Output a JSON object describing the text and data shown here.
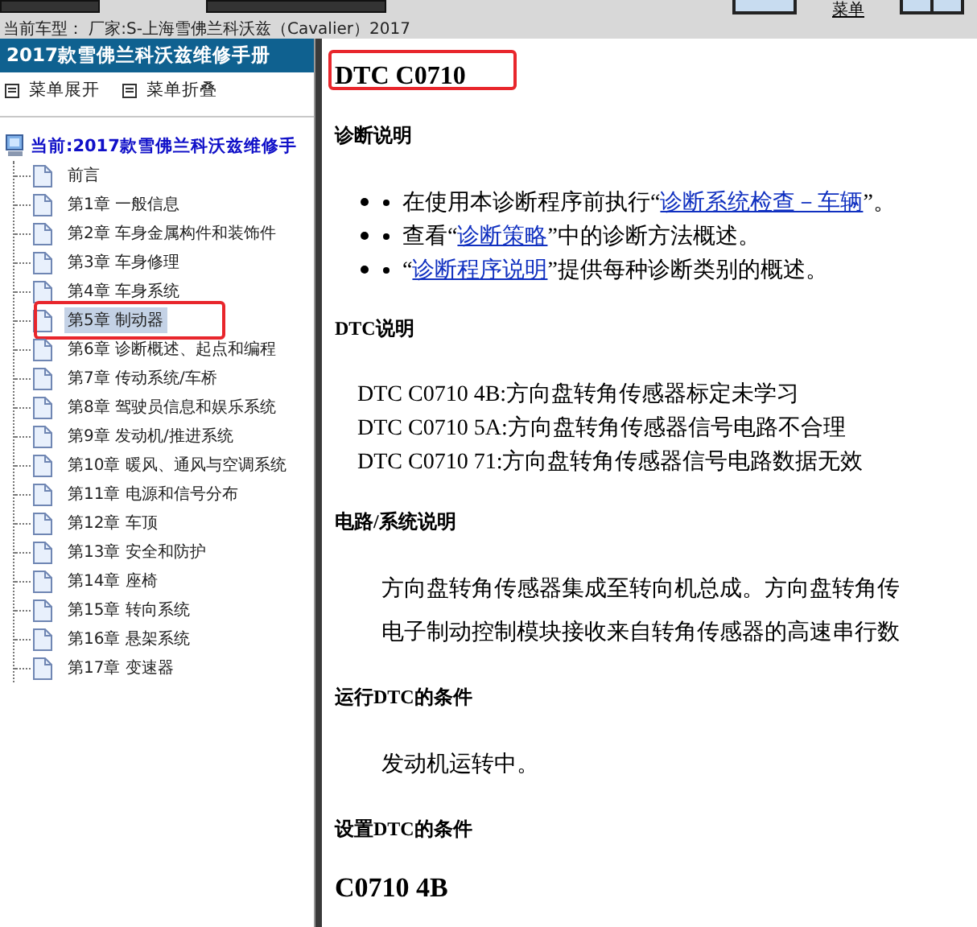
{
  "info_bar": {
    "text": "当前车型： 厂家:S-上海雪佛兰科沃兹（Cavalier）2017"
  },
  "toolbar": {
    "label": "菜单"
  },
  "sidebar": {
    "title": "2017款雪佛兰科沃兹维修手册",
    "menu_actions": [
      "菜单展开",
      "菜单折叠"
    ],
    "tree": {
      "label": "当前:2017款雪佛兰科沃兹维修手",
      "children": [
        {
          "label": "前言",
          "selected": false,
          "highlighted": false
        },
        {
          "label": "第1章 一般信息",
          "selected": false,
          "highlighted": false
        },
        {
          "label": "第2章 车身金属构件和装饰件",
          "selected": false,
          "highlighted": false
        },
        {
          "label": "第3章 车身修理",
          "selected": false,
          "highlighted": false
        },
        {
          "label": "第4章 车身系统",
          "selected": false,
          "highlighted": false
        },
        {
          "label": "第5章 制动器",
          "selected": true,
          "highlighted": true
        },
        {
          "label": "第6章 诊断概述、起点和编程",
          "selected": false,
          "highlighted": false
        },
        {
          "label": "第7章 传动系统/车桥",
          "selected": false,
          "highlighted": false
        },
        {
          "label": "第8章 驾驶员信息和娱乐系统",
          "selected": false,
          "highlighted": false
        },
        {
          "label": "第9章 发动机/推进系统",
          "selected": false,
          "highlighted": false
        },
        {
          "label": "第10章 暖风、通风与空调系统",
          "selected": false,
          "highlighted": false
        },
        {
          "label": "第11章 电源和信号分布",
          "selected": false,
          "highlighted": false
        },
        {
          "label": "第12章 车顶",
          "selected": false,
          "highlighted": false
        },
        {
          "label": "第13章 安全和防护",
          "selected": false,
          "highlighted": false
        },
        {
          "label": "第14章 座椅",
          "selected": false,
          "highlighted": false
        },
        {
          "label": "第15章 转向系统",
          "selected": false,
          "highlighted": false
        },
        {
          "label": "第16章 悬架系统",
          "selected": false,
          "highlighted": false
        },
        {
          "label": "第17章 变速器",
          "selected": false,
          "highlighted": false
        }
      ]
    }
  },
  "document": {
    "heading": {
      "text": "DTC C0710",
      "highlighted": true
    },
    "sections": [
      {
        "kind": "bullets",
        "title": "诊断说明",
        "items": [
          {
            "before": "在使用本诊断程序前执行“",
            "link": "诊断系统检查－车辆",
            "after": "”。"
          },
          {
            "before": "查看“",
            "link": "诊断策略",
            "after": "”中的诊断方法概述。"
          },
          {
            "before": "“",
            "link": "诊断程序说明",
            "after": "”提供每种诊断类别的概述。"
          }
        ]
      },
      {
        "kind": "lines",
        "title": "DTC说明",
        "lines": [
          "DTC C0710 4B:方向盘转角传感器标定未学习",
          "DTC C0710 5A:方向盘转角传感器信号电路不合理",
          "DTC C0710 71:方向盘转角传感器信号电路数据无效"
        ]
      },
      {
        "kind": "paragraph",
        "title": "电路/系统说明",
        "lines": [
          "方向盘转角传感器集成至转向机总成。方向盘转角传",
          "电子制动控制模块接收来自转角传感器的高速串行数"
        ]
      },
      {
        "kind": "paragraph",
        "title": "运行DTC的条件",
        "lines": [
          "发动机运转中。"
        ]
      },
      {
        "kind": "subheading",
        "title": "设置DTC的条件",
        "subheading": "C0710 4B"
      }
    ]
  }
}
